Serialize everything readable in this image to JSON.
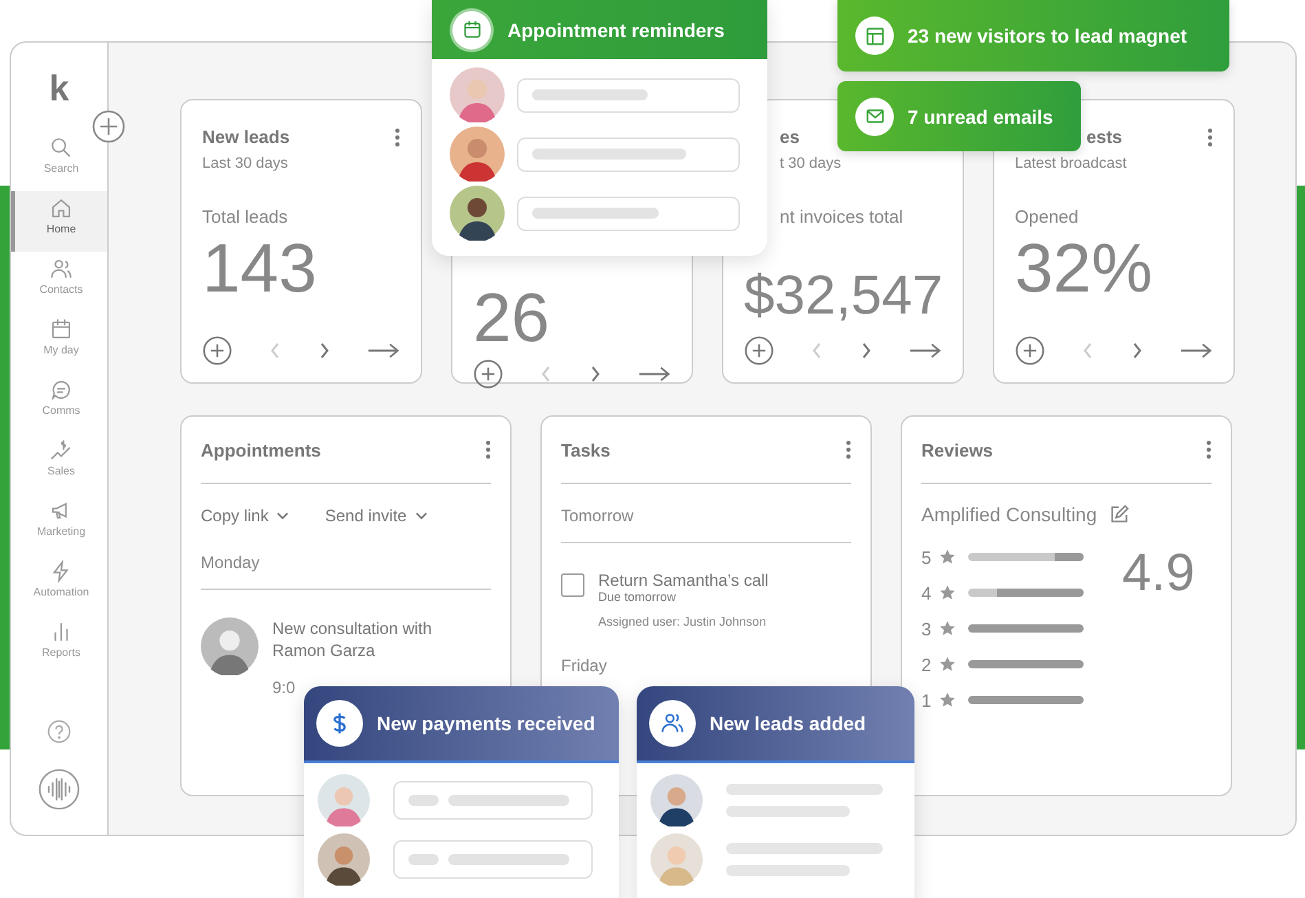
{
  "sidebar": {
    "logo": "k",
    "items": [
      {
        "label": "Search",
        "selected": false
      },
      {
        "label": "Home",
        "selected": true
      },
      {
        "label": "Contacts",
        "selected": false
      },
      {
        "label": "My day",
        "selected": false
      },
      {
        "label": "Comms",
        "selected": false
      },
      {
        "label": "Sales",
        "selected": false
      },
      {
        "label": "Marketing",
        "selected": false
      },
      {
        "label": "Automation",
        "selected": false
      },
      {
        "label": "Reports",
        "selected": false
      }
    ]
  },
  "stat_cards": [
    {
      "title": "New leads",
      "subtitle": "Last 30 days",
      "label": "Total leads",
      "value": "143"
    },
    {
      "value": "26"
    },
    {
      "title": "es",
      "subtitle": "t 30 days",
      "label": "nt invoices total",
      "value": "$32,547"
    },
    {
      "title": "ests",
      "subtitle": "Latest broadcast",
      "label": "Opened",
      "value": "32%"
    }
  ],
  "appointments": {
    "title": "Appointments",
    "actions": [
      "Copy link",
      "Send invite"
    ],
    "day": "Monday",
    "entry": {
      "text": "New consultation with Ramon Garza",
      "time": "9:0"
    }
  },
  "tasks": {
    "title": "Tasks",
    "day": "Tomorrow",
    "task": {
      "title": "Return Samantha’s call",
      "due": "Due tomorrow",
      "assignee": "Assigned user: Justin Johnson",
      "checked": false
    },
    "next_day": "Friday"
  },
  "reviews": {
    "title": "Reviews",
    "business": "Amplified Consulting",
    "rating": "4.9",
    "rows": [
      {
        "label": "5",
        "level": 0.25
      },
      {
        "label": "4",
        "level": 0.75
      },
      {
        "label": "3",
        "level": 1
      },
      {
        "label": "2",
        "level": 1
      },
      {
        "label": "1",
        "level": 1
      }
    ]
  },
  "reminders": {
    "title": "Appointment reminders"
  },
  "notifications": [
    {
      "kind": "visitors",
      "text": "23 new visitors to lead magnet"
    },
    {
      "kind": "email",
      "text": "7 unread emails"
    }
  ],
  "alerts": [
    {
      "kind": "payments",
      "title": "New payments received"
    },
    {
      "kind": "leads",
      "title": "New leads added"
    }
  ]
}
